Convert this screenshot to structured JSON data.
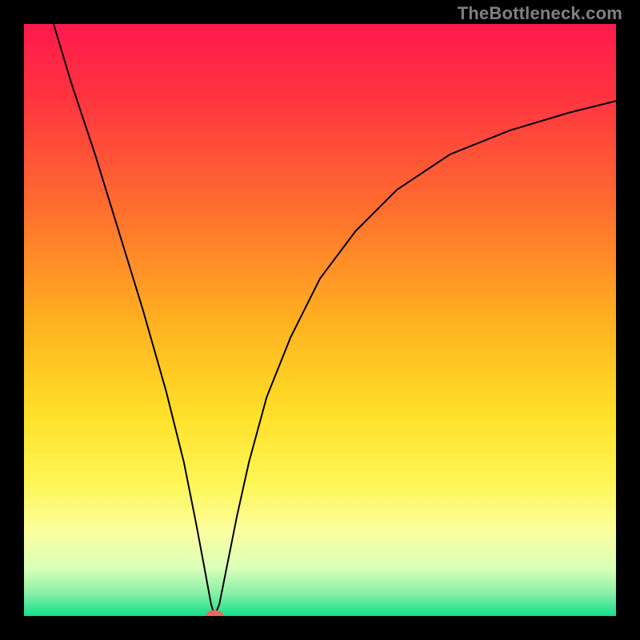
{
  "watermark": "TheBottleneck.com",
  "chart_data": {
    "type": "line",
    "title": "",
    "xlabel": "",
    "ylabel": "",
    "xlim": [
      0,
      100
    ],
    "ylim": [
      0,
      100
    ],
    "background_gradient_stops": [
      {
        "offset": 0,
        "color": "#ff1a4d"
      },
      {
        "offset": 12,
        "color": "#ff3340"
      },
      {
        "offset": 30,
        "color": "#ff6a30"
      },
      {
        "offset": 50,
        "color": "#ffb020"
      },
      {
        "offset": 66,
        "color": "#ffe028"
      },
      {
        "offset": 78,
        "color": "#fff65a"
      },
      {
        "offset": 86,
        "color": "#fbffa0"
      },
      {
        "offset": 92,
        "color": "#d8ffb8"
      },
      {
        "offset": 96,
        "color": "#8cf0a8"
      },
      {
        "offset": 100,
        "color": "#14e08c"
      }
    ],
    "series": [
      {
        "name": "bottleneck-curve",
        "stroke": "#000000",
        "stroke_width": 2,
        "points": [
          {
            "x": 5,
            "y": 100
          },
          {
            "x": 8,
            "y": 90
          },
          {
            "x": 12,
            "y": 78
          },
          {
            "x": 16,
            "y": 65
          },
          {
            "x": 20,
            "y": 52
          },
          {
            "x": 24,
            "y": 38
          },
          {
            "x": 27,
            "y": 26
          },
          {
            "x": 29,
            "y": 16
          },
          {
            "x": 30.5,
            "y": 8
          },
          {
            "x": 31.6,
            "y": 2
          },
          {
            "x": 32.2,
            "y": 0
          },
          {
            "x": 33,
            "y": 2
          },
          {
            "x": 34,
            "y": 7
          },
          {
            "x": 36,
            "y": 17
          },
          {
            "x": 38,
            "y": 26
          },
          {
            "x": 41,
            "y": 37
          },
          {
            "x": 45,
            "y": 47
          },
          {
            "x": 50,
            "y": 57
          },
          {
            "x": 56,
            "y": 65
          },
          {
            "x": 63,
            "y": 72
          },
          {
            "x": 72,
            "y": 78
          },
          {
            "x": 82,
            "y": 82
          },
          {
            "x": 92,
            "y": 85
          },
          {
            "x": 100,
            "y": 87
          }
        ]
      }
    ],
    "marker": {
      "name": "optimal-point",
      "x": 32.2,
      "y": 0,
      "rx": 1.5,
      "ry": 1.0,
      "fill": "#e86a5a"
    }
  }
}
